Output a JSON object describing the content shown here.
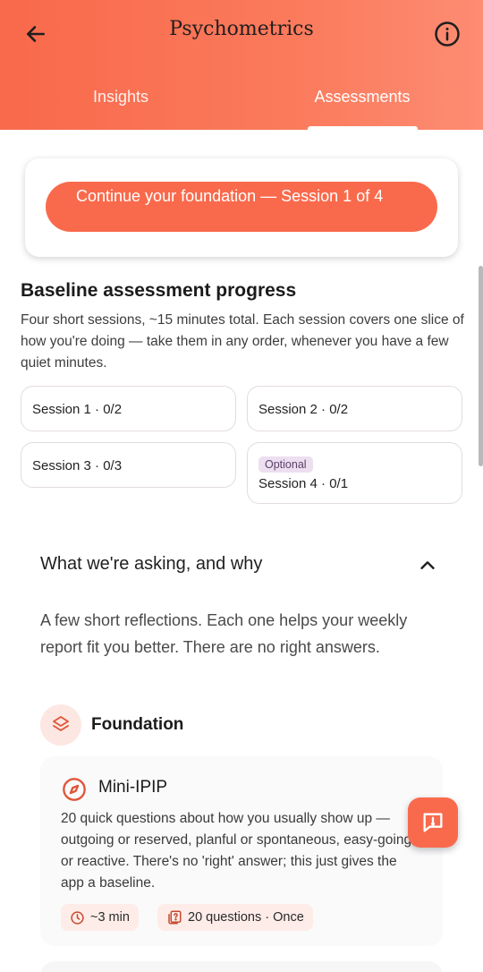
{
  "header": {
    "title": "Psychometrics",
    "tabs": [
      {
        "label": "Insights",
        "active": false
      },
      {
        "label": "Assessments",
        "active": true
      }
    ],
    "accent_color": "#f96a4c"
  },
  "continue_card": {
    "button_label": "Continue your foundation — Session 1 of 4"
  },
  "baseline": {
    "title": "Baseline assessment progress",
    "description": "Four short sessions, ~15 minutes total. Each session covers one slice of how you're doing — take them in any order, whenever you have a few quiet minutes.",
    "sessions": [
      {
        "label": "Session 1 · 0/2"
      },
      {
        "label": "Session 2 · 0/2"
      },
      {
        "label": "Session 3 · 0/3"
      },
      {
        "label": "Session 4 · 0/1",
        "badge": "Optional"
      }
    ]
  },
  "accordion": {
    "title": "What we're asking, and why",
    "expanded": true,
    "description": "A few short reflections. Each one helps your weekly report fit you better. There are no right answers."
  },
  "foundation": {
    "label": "Foundation",
    "icon": "layers-icon",
    "instrument": {
      "title": "Mini-IPIP",
      "icon": "compass-icon",
      "description": "20 quick questions about how you usually show up — outgoing or reserved, planful or spontaneous, easy-going or reactive. There's no 'right' answer; this just gives the app a baseline.",
      "time_chip": "~3 min",
      "questions_chip": "20 questions · Once"
    }
  },
  "fab": {
    "icon": "feedback-icon"
  }
}
